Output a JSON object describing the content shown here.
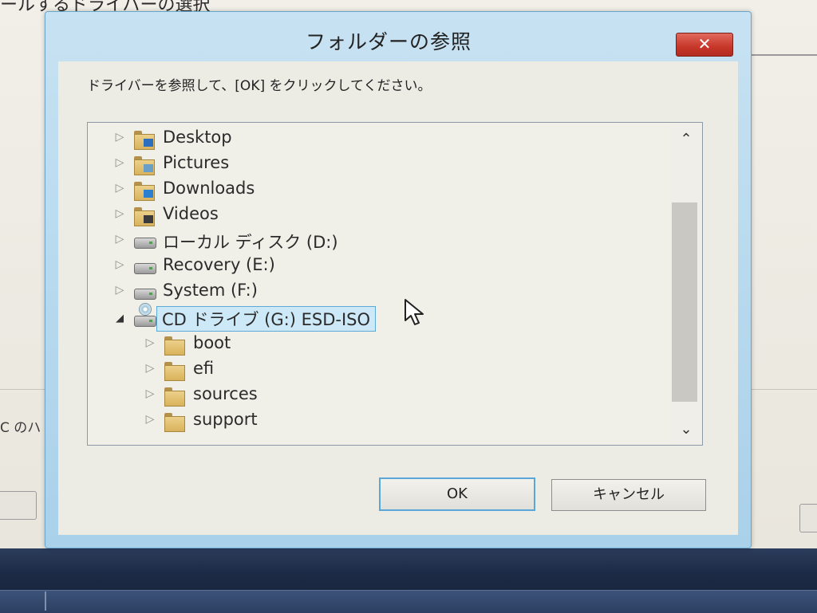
{
  "background_window": {
    "title_fragment": "ールするドライバーの選択",
    "side_label": "C のハ",
    "left_button_label": "",
    "right_button_label": ""
  },
  "dialog": {
    "title": "フォルダーの参照",
    "close_glyph": "✕",
    "instruction": "ドライバーを参照して、[OK] をクリックしてください。",
    "tree_items": [
      {
        "label": "Desktop",
        "icon": "desktop-folder-icon",
        "level": 0,
        "expanded": false,
        "selected": false
      },
      {
        "label": "Pictures",
        "icon": "pictures-folder-icon",
        "level": 0,
        "expanded": false,
        "selected": false
      },
      {
        "label": "Downloads",
        "icon": "downloads-folder-icon",
        "level": 0,
        "expanded": false,
        "selected": false
      },
      {
        "label": "Videos",
        "icon": "videos-folder-icon",
        "level": 0,
        "expanded": false,
        "selected": false
      },
      {
        "label": "ローカル ディスク (D:)",
        "icon": "hard-drive-icon",
        "level": 0,
        "expanded": false,
        "selected": false
      },
      {
        "label": "Recovery (E:)",
        "icon": "hard-drive-icon",
        "level": 0,
        "expanded": false,
        "selected": false
      },
      {
        "label": "System (F:)",
        "icon": "hard-drive-icon",
        "level": 0,
        "expanded": false,
        "selected": false
      },
      {
        "label": "CD ドライブ (G:) ESD-ISO",
        "icon": "cd-drive-icon",
        "level": 0,
        "expanded": true,
        "selected": true
      },
      {
        "label": "boot",
        "icon": "folder-icon",
        "level": 1,
        "expanded": false,
        "selected": false
      },
      {
        "label": "efi",
        "icon": "folder-icon",
        "level": 1,
        "expanded": false,
        "selected": false
      },
      {
        "label": "sources",
        "icon": "folder-icon",
        "level": 1,
        "expanded": false,
        "selected": false
      },
      {
        "label": "support",
        "icon": "folder-icon",
        "level": 1,
        "expanded": false,
        "selected": false
      }
    ],
    "ok_label": "OK",
    "cancel_label": "キャンセル"
  },
  "colors": {
    "dialog_frame": "#a9d1ea",
    "close_button": "#c7372a",
    "selection_bg": "#cde8f6",
    "selection_border": "#5fa9d6",
    "ok_focus_border": "#5aa6d8",
    "taskbar": "#1c2a45"
  }
}
